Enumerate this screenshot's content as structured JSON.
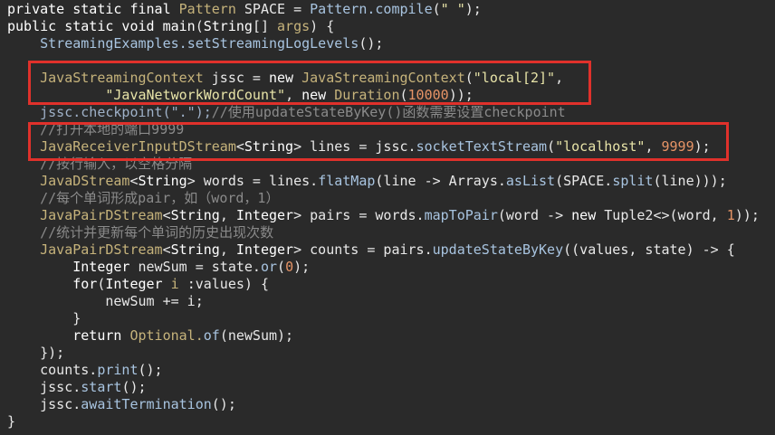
{
  "code_lines": [
    [
      {
        "t": "private static final ",
        "c": "kw"
      },
      {
        "t": "Pattern ",
        "c": "ty"
      },
      {
        "t": "SPACE = ",
        "c": "id"
      },
      {
        "t": "Pattern.compile",
        "c": "fn"
      },
      {
        "t": "(",
        "c": "pu"
      },
      {
        "t": "\" \"",
        "c": "st"
      },
      {
        "t": ");",
        "c": "pu"
      }
    ],
    [
      {
        "t": "public static void ",
        "c": "kw"
      },
      {
        "t": "main",
        "c": "hl"
      },
      {
        "t": "(",
        "c": "pu"
      },
      {
        "t": "String",
        "c": "hl"
      },
      {
        "t": "[] ",
        "c": "pu"
      },
      {
        "t": "args",
        "c": "ty"
      },
      {
        "t": ") {",
        "c": "pu"
      }
    ],
    [
      {
        "t": "    StreamingExamples.",
        "c": "fn"
      },
      {
        "t": "setStreamingLogLevels",
        "c": "fn"
      },
      {
        "t": "();",
        "c": "pu"
      }
    ],
    [],
    [
      {
        "t": "    JavaStreamingContext ",
        "c": "ty"
      },
      {
        "t": "jssc = ",
        "c": "id"
      },
      {
        "t": "new ",
        "c": "kw"
      },
      {
        "t": "JavaStreamingContext",
        "c": "ty"
      },
      {
        "t": "(",
        "c": "pu"
      },
      {
        "t": "\"local[2]\"",
        "c": "st"
      },
      {
        "t": ",",
        "c": "pu"
      }
    ],
    [
      {
        "t": "            ",
        "c": "pu"
      },
      {
        "t": "\"JavaNetworkWordCount\"",
        "c": "st"
      },
      {
        "t": ", ",
        "c": "pu"
      },
      {
        "t": "new ",
        "c": "kw"
      },
      {
        "t": "Duration",
        "c": "ty"
      },
      {
        "t": "(",
        "c": "pu"
      },
      {
        "t": "10000",
        "c": "nu"
      },
      {
        "t": "));",
        "c": "pu"
      }
    ],
    [
      {
        "t": "    jssc.",
        "c": "dim"
      },
      {
        "t": "checkpoint",
        "c": "dim"
      },
      {
        "t": "(\".\");",
        "c": "dim"
      },
      {
        "t": "//使用updateStateByKey()函数需要设置checkpoint",
        "c": "cm"
      }
    ],
    [
      {
        "t": "    //打开本地的端口9999",
        "c": "cm"
      }
    ],
    [
      {
        "t": "    JavaReceiverInputDStream",
        "c": "ty"
      },
      {
        "t": "<",
        "c": "pu"
      },
      {
        "t": "String",
        "c": "hl"
      },
      {
        "t": "> lines = jssc.",
        "c": "id"
      },
      {
        "t": "socketTextStream",
        "c": "fn"
      },
      {
        "t": "(",
        "c": "pu"
      },
      {
        "t": "\"localhost\"",
        "c": "st"
      },
      {
        "t": ", ",
        "c": "pu"
      },
      {
        "t": "9999",
        "c": "nu"
      },
      {
        "t": ");",
        "c": "pu"
      }
    ],
    [
      {
        "t": "    //按行输入，以空格分隔",
        "c": "cm"
      }
    ],
    [
      {
        "t": "    JavaDStream",
        "c": "ty"
      },
      {
        "t": "<",
        "c": "pu"
      },
      {
        "t": "String",
        "c": "hl"
      },
      {
        "t": "> words = lines.",
        "c": "id"
      },
      {
        "t": "flatMap",
        "c": "fn"
      },
      {
        "t": "(line -> Arrays.",
        "c": "id"
      },
      {
        "t": "asList",
        "c": "fn"
      },
      {
        "t": "(SPACE.",
        "c": "id"
      },
      {
        "t": "split",
        "c": "fn"
      },
      {
        "t": "(line)));",
        "c": "pu"
      }
    ],
    [
      {
        "t": "    //每个单词形成pair，如（word，1）",
        "c": "cm"
      }
    ],
    [
      {
        "t": "    JavaPairDStream",
        "c": "ty"
      },
      {
        "t": "<",
        "c": "pu"
      },
      {
        "t": "String",
        "c": "hl"
      },
      {
        "t": ", ",
        "c": "pu"
      },
      {
        "t": "Integer",
        "c": "hl"
      },
      {
        "t": "> pairs = words.",
        "c": "id"
      },
      {
        "t": "mapToPair",
        "c": "fn"
      },
      {
        "t": "(word -> ",
        "c": "id"
      },
      {
        "t": "new ",
        "c": "kw"
      },
      {
        "t": "Tuple2<>",
        "c": "id"
      },
      {
        "t": "(word, ",
        "c": "id"
      },
      {
        "t": "1",
        "c": "nu"
      },
      {
        "t": "));",
        "c": "pu"
      }
    ],
    [
      {
        "t": "    //统计并更新每个单词的历史出现次数",
        "c": "cm"
      }
    ],
    [
      {
        "t": "    JavaPairDStream",
        "c": "ty"
      },
      {
        "t": "<",
        "c": "pu"
      },
      {
        "t": "String",
        "c": "hl"
      },
      {
        "t": ", ",
        "c": "pu"
      },
      {
        "t": "Integer",
        "c": "hl"
      },
      {
        "t": "> counts = pairs.",
        "c": "id"
      },
      {
        "t": "updateStateByKey",
        "c": "fn"
      },
      {
        "t": "((values, state) -> {",
        "c": "id"
      }
    ],
    [
      {
        "t": "        Integer ",
        "c": "hl"
      },
      {
        "t": "newSum = state.",
        "c": "id"
      },
      {
        "t": "or",
        "c": "fn"
      },
      {
        "t": "(",
        "c": "pu"
      },
      {
        "t": "0",
        "c": "nu"
      },
      {
        "t": ");",
        "c": "pu"
      }
    ],
    [
      {
        "t": "        for",
        "c": "kw"
      },
      {
        "t": "(",
        "c": "pu"
      },
      {
        "t": "Integer ",
        "c": "hl"
      },
      {
        "t": "i ",
        "c": "ty"
      },
      {
        "t": ":values) {",
        "c": "id"
      }
    ],
    [
      {
        "t": "            newSum += i;",
        "c": "id"
      }
    ],
    [
      {
        "t": "        }",
        "c": "pu"
      }
    ],
    [
      {
        "t": "        return ",
        "c": "kw"
      },
      {
        "t": "Optional.",
        "c": "ty"
      },
      {
        "t": "of",
        "c": "fn"
      },
      {
        "t": "(newSum);",
        "c": "id"
      }
    ],
    [
      {
        "t": "    });",
        "c": "pu"
      }
    ],
    [
      {
        "t": "    counts.",
        "c": "id"
      },
      {
        "t": "print",
        "c": "fn"
      },
      {
        "t": "();",
        "c": "pu"
      }
    ],
    [
      {
        "t": "    jssc.",
        "c": "id"
      },
      {
        "t": "start",
        "c": "fn"
      },
      {
        "t": "();",
        "c": "pu"
      }
    ],
    [
      {
        "t": "    jssc.",
        "c": "id"
      },
      {
        "t": "awaitTermination",
        "c": "fn"
      },
      {
        "t": "();",
        "c": "pu"
      }
    ],
    [
      {
        "t": "}",
        "c": "pu"
      }
    ]
  ],
  "colors": {
    "background": "#2a2a2a",
    "highlight_border": "#e0312b"
  }
}
